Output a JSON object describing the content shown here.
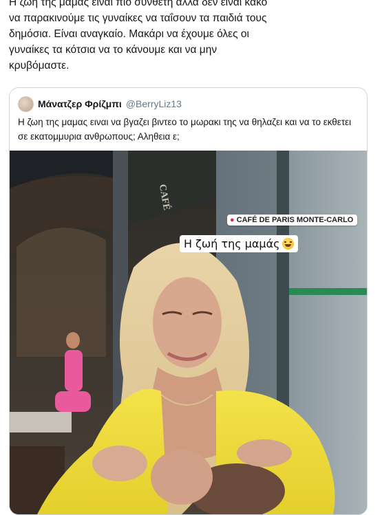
{
  "tweet": {
    "text": "Η ζωή της μαμάς είναι πιο συνθέτη αλλά δεν είναι κακό\nνα παρακινούμε τις γυναίκες να ταΐσουν τα παιδιά τους\nδημόσια. Είναι αναγκαίο. Μακάρι να έχουμε όλες οι\nγυναίκες τα κότσια να το κάνουμε και να μην\nκρυβόμαστε."
  },
  "quoted_tweet": {
    "name": "Μάνατζερ Φρίζμπι",
    "handle": "@BerryLiz13",
    "text": "Η ζωη της μαμας ειναι να βγαζει βιντεο το μωρακι της να θηλαζει και να το εκθετει σε εκατομμυρια ανθρωπους; Αληθεια ε;",
    "media": {
      "location_sticker": "CAFÉ DE PARIS MONTE-CARLO",
      "caption_sticker": "Η ζωή της μαμάς",
      "caption_emoji": "grinning-sweat-emoji",
      "awning_text": "CAFÉ"
    }
  }
}
